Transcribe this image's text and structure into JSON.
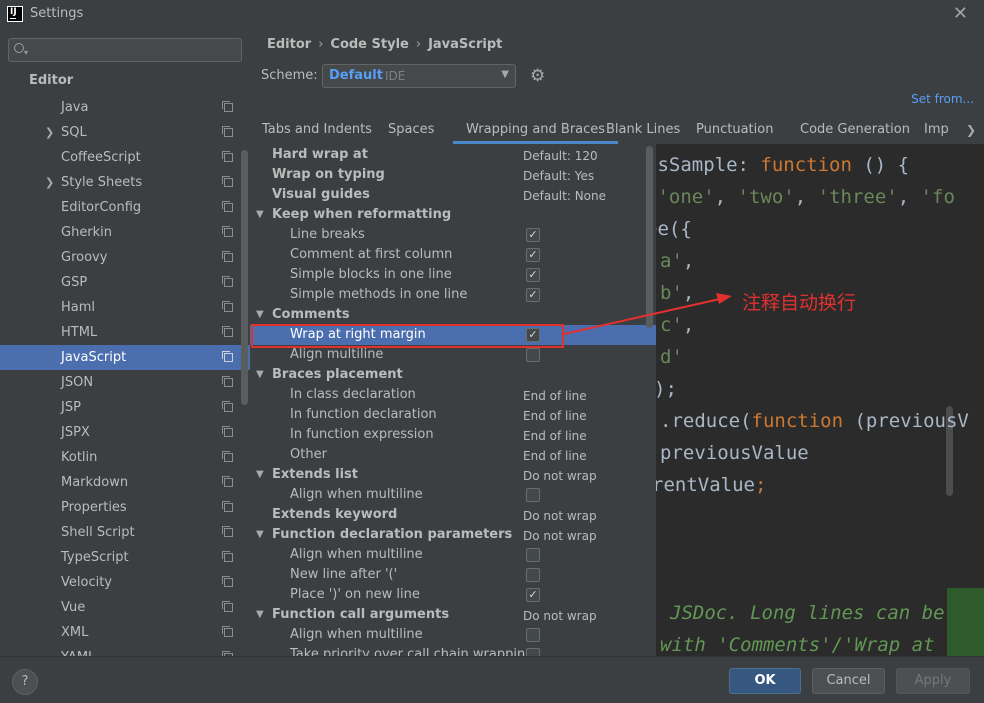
{
  "window": {
    "title": "Settings",
    "logo_text": "IJ"
  },
  "sidebar": {
    "search": {
      "value": "",
      "placeholder": ""
    },
    "section": "Editor",
    "items": [
      {
        "label": "Java",
        "expandable": false
      },
      {
        "label": "SQL",
        "expandable": true
      },
      {
        "label": "CoffeeScript",
        "expandable": false
      },
      {
        "label": "Style Sheets",
        "expandable": true
      },
      {
        "label": "EditorConfig",
        "expandable": false
      },
      {
        "label": "Gherkin",
        "expandable": false
      },
      {
        "label": "Groovy",
        "expandable": false
      },
      {
        "label": "GSP",
        "expandable": false
      },
      {
        "label": "Haml",
        "expandable": false
      },
      {
        "label": "HTML",
        "expandable": false
      },
      {
        "label": "JavaScript",
        "expandable": false,
        "selected": true
      },
      {
        "label": "JSON",
        "expandable": false
      },
      {
        "label": "JSP",
        "expandable": false
      },
      {
        "label": "JSPX",
        "expandable": false
      },
      {
        "label": "Kotlin",
        "expandable": false
      },
      {
        "label": "Markdown",
        "expandable": false
      },
      {
        "label": "Properties",
        "expandable": false
      },
      {
        "label": "Shell Script",
        "expandable": false
      },
      {
        "label": "TypeScript",
        "expandable": false
      },
      {
        "label": "Velocity",
        "expandable": false
      },
      {
        "label": "Vue",
        "expandable": false
      },
      {
        "label": "XML",
        "expandable": false
      },
      {
        "label": "YAML",
        "expandable": false
      }
    ]
  },
  "breadcrumb": [
    "Editor",
    "Code Style",
    "JavaScript"
  ],
  "scheme": {
    "label": "Scheme:",
    "name": "Default",
    "type": "IDE"
  },
  "set_from": "Set from...",
  "tabs": [
    {
      "label": "Tabs and Indents"
    },
    {
      "label": "Spaces"
    },
    {
      "label": "Wrapping and Braces",
      "active": true
    },
    {
      "label": "Blank Lines"
    },
    {
      "label": "Punctuation"
    },
    {
      "label": "Code Generation"
    },
    {
      "label": "Imp"
    }
  ],
  "options": [
    {
      "label": "Hard wrap at",
      "kind": "top",
      "value": "Default: 120"
    },
    {
      "label": "Wrap on typing",
      "kind": "top",
      "value": "Default: Yes"
    },
    {
      "label": "Visual guides",
      "kind": "top",
      "value": "Default: None"
    },
    {
      "label": "Keep when reformatting",
      "kind": "group"
    },
    {
      "label": "Line breaks",
      "kind": "check",
      "checked": true
    },
    {
      "label": "Comment at first column",
      "kind": "check",
      "checked": true
    },
    {
      "label": "Simple blocks in one line",
      "kind": "check",
      "checked": true
    },
    {
      "label": "Simple methods in one line",
      "kind": "check",
      "checked": true
    },
    {
      "label": "Comments",
      "kind": "group"
    },
    {
      "label": "Wrap at right margin",
      "kind": "check",
      "checked": true,
      "highlighted": true
    },
    {
      "label": "Align multiline",
      "kind": "check",
      "checked": false
    },
    {
      "label": "Braces placement",
      "kind": "group"
    },
    {
      "label": "In class declaration",
      "kind": "value",
      "value": "End of line"
    },
    {
      "label": "In function declaration",
      "kind": "value",
      "value": "End of line"
    },
    {
      "label": "In function expression",
      "kind": "value",
      "value": "End of line"
    },
    {
      "label": "Other",
      "kind": "value",
      "value": "End of line"
    },
    {
      "label": "Extends list",
      "kind": "group",
      "value": "Do not wrap"
    },
    {
      "label": "Align when multiline",
      "kind": "check",
      "checked": false
    },
    {
      "label": "Extends keyword",
      "kind": "top",
      "value": "Do not wrap"
    },
    {
      "label": "Function declaration parameters",
      "kind": "group",
      "value": "Do not wrap"
    },
    {
      "label": "Align when multiline",
      "kind": "check",
      "checked": false
    },
    {
      "label": "New line after '('",
      "kind": "check",
      "checked": false
    },
    {
      "label": "Place ')' on new line",
      "kind": "check",
      "checked": true
    },
    {
      "label": "Function call arguments",
      "kind": "group",
      "value": "Do not wrap"
    },
    {
      "label": "Align when multiline",
      "kind": "check",
      "checked": false
    },
    {
      "label": "Take priority over call chain wrapping",
      "kind": "check",
      "checked": false
    }
  ],
  "code_lines": [
    [
      [
        "def",
        "tsSample: "
      ],
      [
        "kw",
        "function"
      ],
      [
        "def",
        " () {"
      ]
    ],
    [
      [
        "def",
        "("
      ],
      [
        "str",
        "'one'"
      ],
      [
        "def",
        ", "
      ],
      [
        "str",
        "'two'"
      ],
      [
        "def",
        ", "
      ],
      [
        "str",
        "'three'"
      ],
      [
        "def",
        ", "
      ],
      [
        "str",
        "'fo"
      ]
    ],
    [
      [
        "def",
        "ee({"
      ]
    ],
    [
      [
        "str",
        "a'"
      ],
      [
        "def",
        ","
      ]
    ],
    [
      [
        "str",
        "b'"
      ],
      [
        "def",
        ","
      ]
    ],
    [
      [
        "str",
        "c'"
      ],
      [
        "def",
        ","
      ]
    ],
    [
      [
        "str",
        "d'"
      ]
    ],
    [
      [
        "def",
        ");"
      ]
    ],
    [
      [
        "def",
        ".reduce("
      ],
      [
        "kw",
        "function"
      ],
      [
        "def",
        " (previousV"
      ]
    ],
    [
      [
        "def",
        "previousValue"
      ]
    ],
    [
      [
        "def",
        "rentValue"
      ],
      [
        "kw",
        ";"
      ]
    ],
    [
      [
        "doc",
        "JSDoc. Long lines can be"
      ]
    ],
    [
      [
        "doc",
        "with 'Comments'/'Wrap at"
      ]
    ]
  ],
  "annotation": {
    "text": "注释自动换行",
    "color": "#e0312f"
  },
  "buttons": {
    "help": "?",
    "ok": "OK",
    "cancel": "Cancel",
    "apply": "Apply"
  },
  "colors": {
    "accent": "#4b6eaf",
    "link": "#589df6",
    "keyword": "#cc7832",
    "string": "#6a8759",
    "doc": "#629755"
  }
}
